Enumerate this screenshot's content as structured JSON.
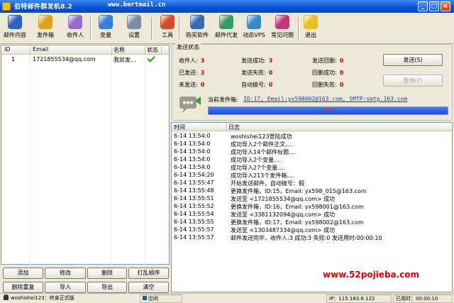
{
  "window": {
    "title": "伯特邮件群发机8.2",
    "site": "www.bertmail.cn"
  },
  "toolbar": [
    {
      "label": "邮件内容",
      "icon": "books-icon",
      "color": "#2f5fc8"
    },
    {
      "label": "发件箱",
      "icon": "envelope-icon",
      "color": "#e0a020"
    },
    {
      "label": "收件人",
      "icon": "contacts-icon",
      "color": "#9a6ac8"
    },
    {
      "label": "变量",
      "icon": "gear-variable-icon",
      "color": "#3a7ad8"
    },
    {
      "label": "设置",
      "icon": "wrench-icon",
      "color": "#7a8aa8"
    },
    {
      "label": "工具",
      "icon": "toolbox-icon",
      "color": "#d84a2a"
    },
    {
      "label": "购买软件",
      "icon": "computer-icon",
      "color": "#3a6ab0"
    },
    {
      "label": "邮件代发",
      "icon": "network-icon",
      "color": "#3a9a6a"
    },
    {
      "label": "动态VPS",
      "icon": "globe-icon",
      "color": "#3a8ac8"
    },
    {
      "label": "常见问题",
      "icon": "help-icon",
      "color": "#c03878"
    },
    {
      "label": "退出",
      "icon": "exit-icon",
      "color": "#e8c020"
    }
  ],
  "recipients": {
    "columns": [
      "ID",
      "Email",
      "名称",
      "状态"
    ],
    "rows": [
      {
        "id": "1",
        "email": "1721855534@qq.com",
        "name": "我就发…",
        "status": "ok"
      }
    ]
  },
  "left_buttons": [
    [
      "添加",
      "修改",
      "删除",
      "打乱顺序"
    ],
    [
      "删除重复",
      "导入",
      "导出",
      "清空"
    ]
  ],
  "send_status": {
    "title": "发送状态",
    "stats": [
      {
        "label": "收件人:",
        "value": "3"
      },
      {
        "label": "发送成功:",
        "value": "3"
      },
      {
        "label": "发送回删:",
        "value": "0"
      },
      {
        "label": "已发送:",
        "value": "3"
      },
      {
        "label": "发送失败:",
        "value": "0"
      },
      {
        "label": "回删成功:",
        "value": "0"
      },
      {
        "label": "未发送:",
        "value": "0"
      },
      {
        "label": "自动拨号:",
        "value": "0"
      },
      {
        "label": "回删失败:",
        "value": "0"
      }
    ],
    "send_button": "发送(S)",
    "pause_button": "暂停(P)",
    "current_sender_label": "当前发件箱:",
    "current_sender": "ID:17, Email:yx598002@163.com, SMTP:smtp.163.com",
    "progress_text": "100%",
    "progress": 1.0
  },
  "log": {
    "columns": [
      "时间",
      "日志"
    ],
    "rows": [
      [
        "6-14 13:54:0",
        "woshishei123登陆成功"
      ],
      [
        "6-14 13:54:0",
        "成功导入2个邮件正文...."
      ],
      [
        "6-14 13:54:0",
        "成功导入14个邮件标题...."
      ],
      [
        "6-14 13:54:0",
        "成功导入2个变量...."
      ],
      [
        "6-14 13:54:0",
        "成功导入27个变量...."
      ],
      [
        "6-14 13:54:20",
        "成功导入213个发件箱...."
      ],
      [
        "6-14 13:55:47",
        "开始发送邮件，自动拨号：假"
      ],
      [
        "6-14 13:55:48",
        "更换发件箱，ID:15，Email: yx598_015@163.com"
      ],
      [
        "6-14 13:55:51",
        "发送至 <1721855534@qq.com> 成功"
      ],
      [
        "6-14 13:55:52",
        "更换发件箱，ID:16，Email: yx598001@163.com"
      ],
      [
        "6-14 13:55:54",
        "发送至 <3381132094@qq.com> 成功"
      ],
      [
        "6-14 13:55:55",
        "更换发件箱，ID:17，Email: yx598002@163.com"
      ],
      [
        "6-14 13:55:57",
        "发送至 <1303487334@qq.com> 成功"
      ],
      [
        "6-14 13:55:57",
        "邮件发送完毕，收件人:3 成功:3 失败:0 发送用时:00:00:10"
      ]
    ]
  },
  "watermark": "www.52pojieba.com",
  "statusbar": {
    "user": "woshishei123：终身正式版",
    "idle": "空闲",
    "ip": "IP：115.183.6.122",
    "elapsed": "已用时：00:00:10"
  }
}
